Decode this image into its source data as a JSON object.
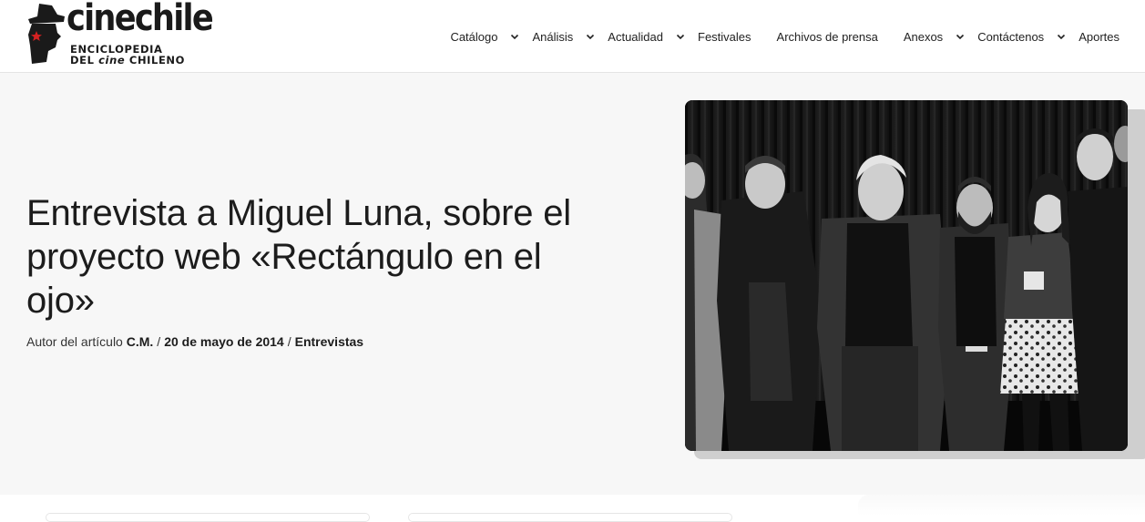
{
  "brand": {
    "name": "cinechile",
    "subtitle_line1": "ENCICLOPEDIA",
    "subtitle_line2_a": "DEL ",
    "subtitle_line2_b": "cine",
    "subtitle_line2_c": " CHILENO",
    "accent_color": "#d42121"
  },
  "nav": {
    "items": [
      {
        "label": "Catálogo",
        "has_dropdown": true
      },
      {
        "label": "Análisis",
        "has_dropdown": true
      },
      {
        "label": "Actualidad",
        "has_dropdown": true
      },
      {
        "label": "Festivales",
        "has_dropdown": false
      },
      {
        "label": "Archivos de prensa",
        "has_dropdown": false
      },
      {
        "label": "Anexos",
        "has_dropdown": true
      },
      {
        "label": "Contáctenos",
        "has_dropdown": true
      },
      {
        "label": "Aportes",
        "has_dropdown": false
      }
    ]
  },
  "article": {
    "title": "Entrevista a Miguel Luna, sobre el proyecto web «Rectángulo en el ojo»",
    "author_prefix": "Autor del artículo ",
    "author": "C.M.",
    "separator": "/",
    "date": "20 de mayo de 2014",
    "category": "Entrevistas",
    "featured_image": "black-and-white group photo of people standing in front of a dark curtain"
  }
}
